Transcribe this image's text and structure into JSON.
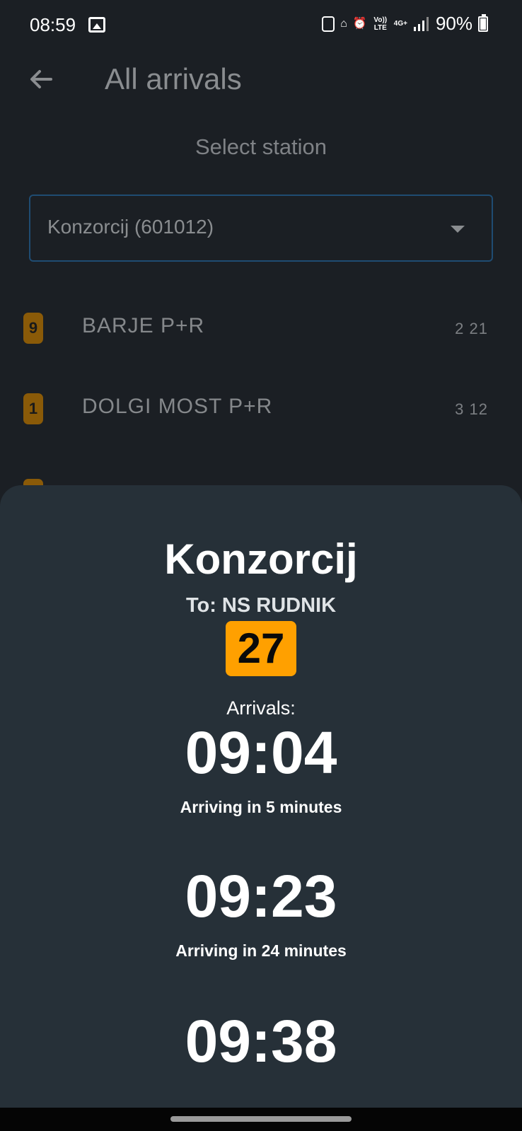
{
  "status_bar": {
    "time": "08:59",
    "battery": "90%",
    "icons": [
      "gallery-icon",
      "sim-icon",
      "home-icon",
      "alarm-icon",
      "volte-icon",
      "4g-icon",
      "signal-icon",
      "battery-icon"
    ],
    "volte": "Vo)) LTE",
    "network": "4G+"
  },
  "app_bar": {
    "title": "All arrivals"
  },
  "station": {
    "label": "Select station",
    "selected": "Konzorcij (601012)"
  },
  "routes": [
    {
      "number": "9",
      "name": "BARJE P+R",
      "times": "2 21"
    },
    {
      "number": "1",
      "name": "DOLGI MOST P+R",
      "times": "3 12"
    }
  ],
  "sheet": {
    "station_name": "Konzorcij",
    "destination": "To: NS RUDNIK",
    "line": "27",
    "arrivals_label": "Arrivals:",
    "arrivals": [
      {
        "time": "09:04",
        "note": "Arriving in 5 minutes"
      },
      {
        "time": "09:23",
        "note": "Arriving in 24 minutes"
      },
      {
        "time": "09:38"
      }
    ]
  },
  "colors": {
    "background": "#1b1f24",
    "sheet": "#263038",
    "line_badge": "#ffa000",
    "dropdown_border": "#1f4c72"
  }
}
